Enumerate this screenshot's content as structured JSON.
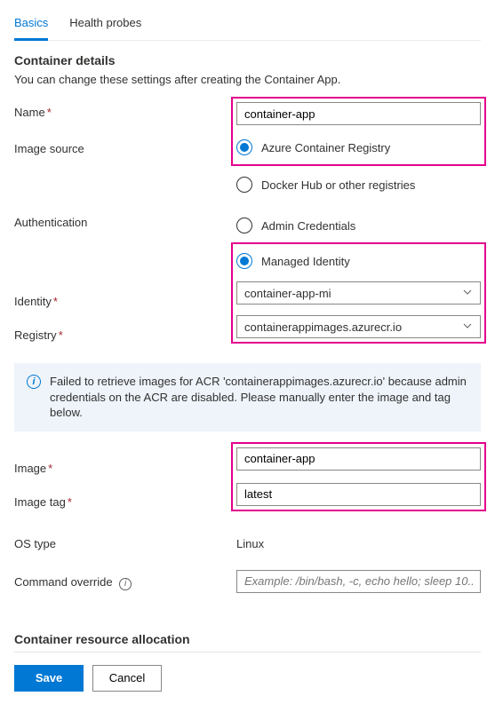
{
  "tabs": {
    "basics": "Basics",
    "health_probes": "Health probes"
  },
  "section1": {
    "heading": "Container details",
    "desc": "You can change these settings after creating the Container App.",
    "name_label": "Name",
    "name_value": "container-app",
    "image_source_label": "Image source",
    "radio_acr": "Azure Container Registry",
    "radio_docker": "Docker Hub or other registries",
    "auth_label": "Authentication",
    "radio_admin": "Admin Credentials",
    "radio_managed": "Managed Identity",
    "identity_label": "Identity",
    "identity_value": "container-app-mi",
    "registry_label": "Registry",
    "registry_value": "containerappimages.azurecr.io"
  },
  "info": {
    "text": "Failed to retrieve images for ACR 'containerappimages.azurecr.io' because admin credentials on the ACR are disabled. Please manually enter the image and tag below."
  },
  "section2": {
    "image_label": "Image",
    "image_value": "container-app",
    "tag_label": "Image tag",
    "tag_value": "latest",
    "os_label": "OS type",
    "os_value": "Linux",
    "cmd_label": "Command override",
    "cmd_placeholder": "Example: /bin/bash, -c, echo hello; sleep 10..."
  },
  "section3": {
    "heading": "Container resource allocation"
  },
  "footer": {
    "save": "Save",
    "cancel": "Cancel"
  }
}
